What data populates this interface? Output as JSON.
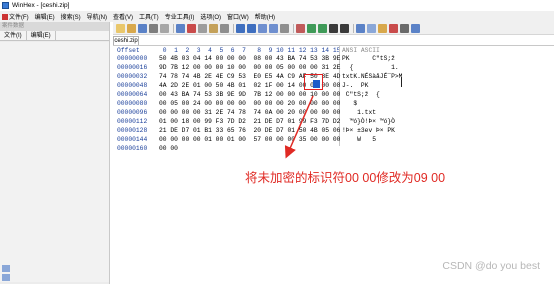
{
  "window": {
    "title": "WinHex - [ceshi.zip]"
  },
  "menubar": {
    "items": [
      "文件(F)",
      "编辑(E)",
      "搜索(S)",
      "导航(N)",
      "查看(V)",
      "工具(T)",
      "专业工具(I)",
      "选项(O)",
      "窗口(W)",
      "帮助(H)"
    ]
  },
  "left_panel": {
    "header": "案件数据",
    "tabs": [
      "文件(I)",
      "编辑(E)"
    ]
  },
  "document_tab": "ceshi.zip",
  "hex": {
    "header_offset": "Offset",
    "header_bytes": " 0  1  2  3  4  5  6  7   8  9 10 11 12 13 14 15",
    "header_ascii": "ANSI ASCII",
    "rows": [
      {
        "offset": "00000000",
        "bytes": "50 4B 03 04 14 00 00 00  08 00 43 BA 74 53 3B 9E",
        "ascii": "PK      C\"tS;ž"
      },
      {
        "offset": "00000016",
        "bytes": "9D 7B 12 00 00 00 10 00  00 00 05 00 00 00 31 2E",
        "ascii": "  {          1."
      },
      {
        "offset": "00000032",
        "bytes": "74 78 74 4B 2E 4E C9 53  E0 E5 4A C9 AF 50 3E 4D",
        "ascii": "txtK.NÉSàåJÉ¯P>M"
      },
      {
        "offset": "00000048",
        "bytes": "4A 2D 2E 01 00 50 4B 01  02 1F 00 14 00 09 00 08",
        "ascii": "J-.  PK"
      },
      {
        "offset": "00000064",
        "bytes": "00 43 BA 74 53 3B 9E 9D  7B 12 00 00 00 10 00 00",
        "ascii": " C\"tS;ž  {"
      },
      {
        "offset": "00000080",
        "bytes": "00 05 00 24 00 00 00 00  00 00 00 20 00 00 00 00",
        "ascii": "   $"
      },
      {
        "offset": "00000096",
        "bytes": "00 00 00 00 31 2E 74 78  74 0A 00 20 00 00 00 00",
        "ascii": "    1.txt"
      },
      {
        "offset": "00000112",
        "bytes": "01 00 18 00 99 F3 7D D2  21 DE D7 01 99 F3 7D D2",
        "ascii": "  ™ó}Ò!Þ× ™ó}Ò"
      },
      {
        "offset": "00000128",
        "bytes": "21 DE D7 01 B1 33 65 76  20 DE D7 01 50 4B 05 06",
        "ascii": "!Þ× ±3ev Þ× PK"
      },
      {
        "offset": "00000144",
        "bytes": "00 00 00 00 01 00 01 00  57 00 00 00 35 00 00 00",
        "ascii": "    W   5"
      },
      {
        "offset": "00000160",
        "bytes": "00 00",
        "ascii": ""
      }
    ]
  },
  "annotation": {
    "text": "将未加密的标识符00 00修改为09 00",
    "color": "#e02a24"
  },
  "watermark": "CSDN @do you best",
  "colors": {
    "highlight_box": "#e02020",
    "selection": "#1b5ac9",
    "offset_text": "#1a3f9a"
  }
}
